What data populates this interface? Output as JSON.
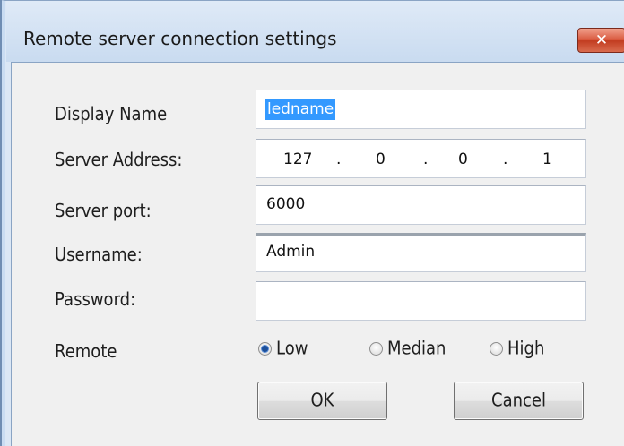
{
  "dialog": {
    "title": "Remote server connection settings",
    "close_glyph": "✕"
  },
  "form": {
    "display_name": {
      "label": "Display Name",
      "value": "ledname"
    },
    "server_address": {
      "label": "Server Address:",
      "octets": [
        "127",
        "0",
        "0",
        "1"
      ],
      "separator": "."
    },
    "server_port": {
      "label": "Server port:",
      "value": "6000"
    },
    "username": {
      "label": "Username:",
      "value": "Admin"
    },
    "password": {
      "label": "Password:",
      "value": ""
    },
    "remote": {
      "label": "Remote",
      "options": [
        {
          "label": "Low",
          "selected": true
        },
        {
          "label": "Median",
          "selected": false
        },
        {
          "label": "High",
          "selected": false
        }
      ]
    }
  },
  "buttons": {
    "ok": "OK",
    "cancel": "Cancel"
  },
  "colors": {
    "selection": "#3399ff",
    "close_button": "#c23c20",
    "dialog_bg": "#f0f0f0"
  }
}
